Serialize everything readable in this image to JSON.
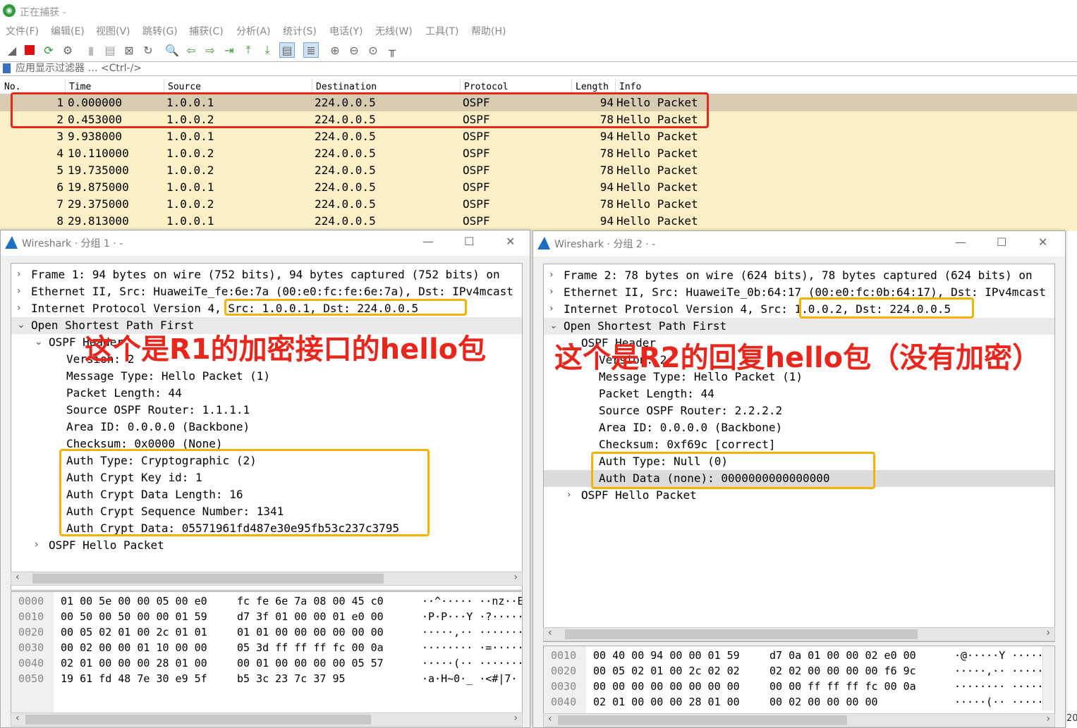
{
  "window_title": "正在捕获 -",
  "menu": [
    "文件(F)",
    "编辑(E)",
    "视图(V)",
    "跳转(G)",
    "捕获(C)",
    "分析(A)",
    "统计(S)",
    "电话(Y)",
    "无线(W)",
    "工具(T)",
    "帮助(H)"
  ],
  "filter_placeholder": "应用显示过滤器 … <Ctrl-/>",
  "columns": {
    "no": "No.",
    "time": "Time",
    "source": "Source",
    "destination": "Destination",
    "protocol": "Protocol",
    "length": "Length",
    "info": "Info"
  },
  "packets": [
    {
      "no": "1",
      "time": "0.000000",
      "src": "1.0.0.1",
      "dst": "224.0.0.5",
      "proto": "OSPF",
      "len": "94",
      "info": "Hello Packet"
    },
    {
      "no": "2",
      "time": "0.453000",
      "src": "1.0.0.2",
      "dst": "224.0.0.5",
      "proto": "OSPF",
      "len": "78",
      "info": "Hello Packet"
    },
    {
      "no": "3",
      "time": "9.938000",
      "src": "1.0.0.1",
      "dst": "224.0.0.5",
      "proto": "OSPF",
      "len": "94",
      "info": "Hello Packet"
    },
    {
      "no": "4",
      "time": "10.110000",
      "src": "1.0.0.2",
      "dst": "224.0.0.5",
      "proto": "OSPF",
      "len": "78",
      "info": "Hello Packet"
    },
    {
      "no": "5",
      "time": "19.735000",
      "src": "1.0.0.2",
      "dst": "224.0.0.5",
      "proto": "OSPF",
      "len": "78",
      "info": "Hello Packet"
    },
    {
      "no": "6",
      "time": "19.875000",
      "src": "1.0.0.1",
      "dst": "224.0.0.5",
      "proto": "OSPF",
      "len": "94",
      "info": "Hello Packet"
    },
    {
      "no": "7",
      "time": "29.375000",
      "src": "1.0.0.2",
      "dst": "224.0.0.5",
      "proto": "OSPF",
      "len": "78",
      "info": "Hello Packet"
    },
    {
      "no": "8",
      "time": "29.813000",
      "src": "1.0.0.1",
      "dst": "224.0.0.5",
      "proto": "OSPF",
      "len": "94",
      "info": "Hello Packet"
    }
  ],
  "win1": {
    "title": "Wireshark · 分组 1 · -",
    "tree": [
      {
        "arrow": "›",
        "text": "Frame 1: 94 bytes on wire (752 bits), 94 bytes captured (752 bits) on"
      },
      {
        "arrow": "›",
        "text": "Ethernet II, Src: HuaweiTe_fe:6e:7a (00:e0:fc:fe:6e:7a), Dst: IPv4mcast"
      },
      {
        "arrow": "›",
        "text": "Internet Protocol Version 4, Src: 1.0.0.1, Dst: 224.0.0.5"
      },
      {
        "arrow": "⌄",
        "text": "Open Shortest Path First"
      },
      {
        "arrow": "⌄",
        "text": "OSPF Header"
      },
      {
        "arrow": "",
        "text": "Version: 2"
      },
      {
        "arrow": "",
        "text": "Message Type: Hello Packet (1)"
      },
      {
        "arrow": "",
        "text": "Packet Length: 44"
      },
      {
        "arrow": "",
        "text": "Source OSPF Router: 1.1.1.1"
      },
      {
        "arrow": "",
        "text": "Area ID: 0.0.0.0 (Backbone)"
      },
      {
        "arrow": "",
        "text": "Checksum: 0x0000 (None)"
      },
      {
        "arrow": "",
        "text": "Auth Type: Cryptographic (2)"
      },
      {
        "arrow": "",
        "text": "Auth Crypt Key id: 1"
      },
      {
        "arrow": "",
        "text": "Auth Crypt Data Length: 16"
      },
      {
        "arrow": "",
        "text": "Auth Crypt Sequence Number: 1341"
      },
      {
        "arrow": "",
        "text": "Auth Crypt Data: 05571961fd487e30e95fb53c237c3795"
      },
      {
        "arrow": "›",
        "text": "OSPF Hello Packet"
      }
    ],
    "hex": [
      {
        "off": "0000",
        "a": "01 00 5e 00 00 05 00 e0",
        "b": "fc fe 6e 7a 08 00 45 c0",
        "ascii": "··^····· ··nz··E·"
      },
      {
        "off": "0010",
        "a": "00 50 00 50 00 00 01 59",
        "b": "d7 3f 01 00 00 01 e0 00",
        "ascii": "·P·P···Y ·?······"
      },
      {
        "off": "0020",
        "a": "00 05 02 01 00 2c 01 01",
        "b": "01 01 00 00 00 00 00 00",
        "ascii": "·····,·· ········"
      },
      {
        "off": "0030",
        "a": "00 02 00 00 01 10 00 00",
        "b": "05 3d ff ff ff fc 00 0a",
        "ascii": "········ ·=······"
      },
      {
        "off": "0040",
        "a": "02 01 00 00 00 28 01 00",
        "b": "00 01 00 00 00 00 05 57",
        "ascii": "·····(·· ·······W"
      },
      {
        "off": "0050",
        "a": "19 61 fd 48 7e 30 e9 5f",
        "b": "b5 3c 23 7c 37 95",
        "ascii": "·a·H~0·_ ·<#|7·"
      }
    ],
    "annotation": "这个是R1的加密接口的hello包"
  },
  "win2": {
    "title": "Wireshark · 分组 2 · -",
    "tree": [
      {
        "arrow": "›",
        "text": "Frame 2: 78 bytes on wire (624 bits), 78 bytes captured (624 bits) on"
      },
      {
        "arrow": "›",
        "text": "Ethernet II, Src: HuaweiTe_0b:64:17 (00:e0:fc:0b:64:17), Dst: IPv4mcast"
      },
      {
        "arrow": "›",
        "text": "Internet Protocol Version 4, Src: 1.0.0.2, Dst: 224.0.0.5"
      },
      {
        "arrow": "⌄",
        "text": "Open Shortest Path First"
      },
      {
        "arrow": "⌄",
        "text": "OSPF Header"
      },
      {
        "arrow": "",
        "text": "Version: 2"
      },
      {
        "arrow": "",
        "text": "Message Type: Hello Packet (1)"
      },
      {
        "arrow": "",
        "text": "Packet Length: 44"
      },
      {
        "arrow": "",
        "text": "Source OSPF Router: 2.2.2.2"
      },
      {
        "arrow": "",
        "text": "Area ID: 0.0.0.0 (Backbone)"
      },
      {
        "arrow": "",
        "text": "Checksum: 0xf69c [correct]"
      },
      {
        "arrow": "",
        "text": "Auth Type: Null (0)"
      },
      {
        "arrow": "",
        "text": "Auth Data (none): 0000000000000000"
      },
      {
        "arrow": "›",
        "text": "OSPF Hello Packet"
      }
    ],
    "hex": [
      {
        "off": "0010",
        "a": "00 40 00 94 00 00 01 59",
        "b": "d7 0a 01 00 00 02 e0 00",
        "ascii": "·@·····Y ········"
      },
      {
        "off": "0020",
        "a": "00 05 02 01 00 2c 02 02",
        "b": "02 02 00 00 00 00 f6 9c",
        "ascii": "·····,·· ········"
      },
      {
        "off": "0030",
        "a": "00 00 00 00 00 00 00 00",
        "b": "00 00 ff ff ff fc 00 0a",
        "ascii": "········ ········"
      },
      {
        "off": "0040",
        "a": "02 01 00 00 00 28 01 00",
        "b": "00 02 00 00 00 00",
        "ascii": "·····(·· ······"
      }
    ],
    "annotation": "这个是R2的回复hello包（没有加密）"
  },
  "window_buttons": {
    "min": "—",
    "max": "☐",
    "close": "✕"
  },
  "corner_text": "20"
}
